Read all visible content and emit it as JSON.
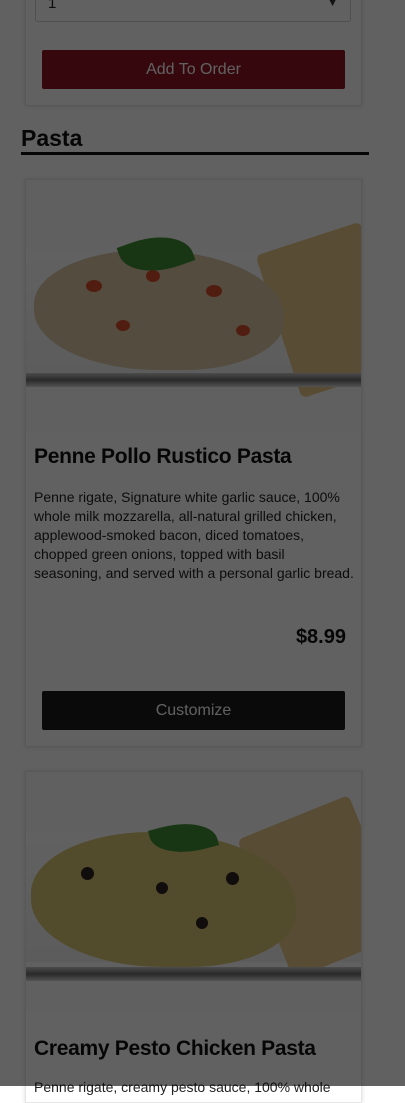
{
  "top_item": {
    "quantity_value": "1",
    "add_to_order_label": "Add To Order"
  },
  "section": {
    "title": "Pasta"
  },
  "items": [
    {
      "name": "Penne Pollo Rustico Pasta",
      "description": "Penne rigate, Signature white garlic sauce, 100% whole milk mozzarella, all-natural grilled chicken, applewood-smoked bacon, diced tomatoes, chopped green onions, topped with basil seasoning, and served with a personal garlic bread.",
      "price": "$8.99",
      "customize_label": "Customize"
    },
    {
      "name": "Creamy Pesto Chicken Pasta",
      "description": "Penne rigate, creamy pesto sauce, 100% whole"
    }
  ],
  "colors": {
    "add_button": "#8f1522",
    "customize_button": "#1b1b1b",
    "overlay": "rgba(0,0,0,0.62)"
  }
}
